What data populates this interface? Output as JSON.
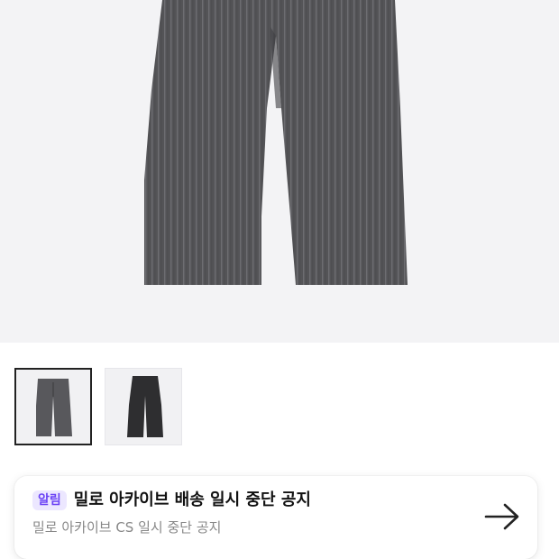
{
  "product": {
    "main_image": "gray-pinstripe-pants-photo",
    "thumbnails": [
      {
        "name": "thumb-gray-pinstripe",
        "selected": true
      },
      {
        "name": "thumb-charcoal",
        "selected": false
      }
    ]
  },
  "notice": {
    "badge": "알림",
    "title": "밀로 아카이브 배송 일시 중단 공지",
    "subtitle": "밀로 아카이브 CS 일시 중단 공지",
    "arrow_icon": "arrow-right-icon"
  },
  "colors": {
    "badge_bg": "#ece7ff",
    "badge_text": "#6b43f5",
    "pants_gray": "#555558",
    "pants_charcoal": "#2e2e30"
  }
}
